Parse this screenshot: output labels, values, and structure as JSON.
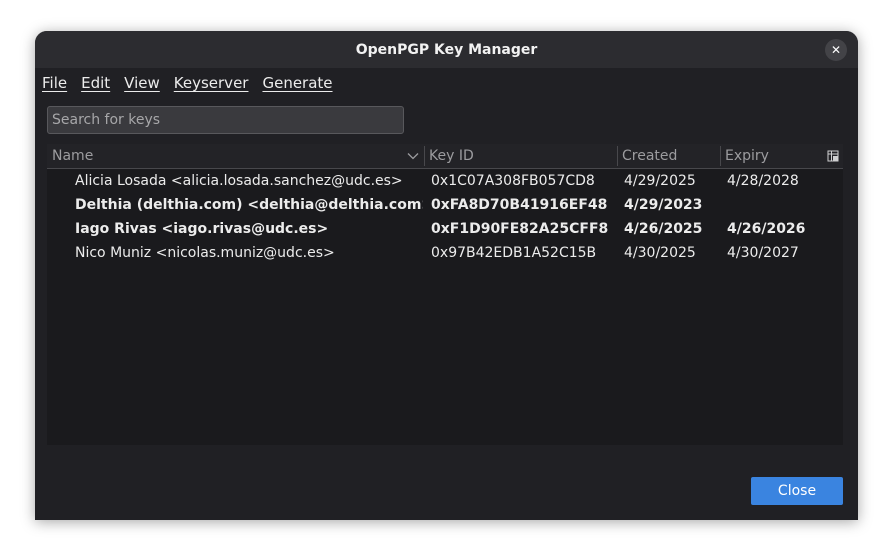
{
  "window": {
    "title": "OpenPGP Key Manager",
    "close_glyph": "✕"
  },
  "menubar": {
    "items": [
      {
        "label": "File"
      },
      {
        "label": "Edit"
      },
      {
        "label": "View"
      },
      {
        "label": "Keyserver"
      },
      {
        "label": "Generate"
      }
    ]
  },
  "search": {
    "placeholder": "Search for keys",
    "value": ""
  },
  "table": {
    "columns": [
      {
        "label": "Name"
      },
      {
        "label": "Key ID"
      },
      {
        "label": "Created"
      },
      {
        "label": "Expiry"
      }
    ],
    "sort_icon": "chevron-down-icon",
    "column_picker_icon": "column-picker-icon",
    "rows": [
      {
        "name": "Alicia Losada <alicia.losada.sanchez@udc.es>",
        "key_id": "0x1C07A308FB057CD8",
        "created": "4/29/2025",
        "expiry": "4/28/2028",
        "bold": false
      },
      {
        "name": "Delthia (delthia.com) <delthia@delthia.com>",
        "key_id": "0xFA8D70B41916EF48",
        "created": "4/29/2023",
        "expiry": "",
        "bold": true
      },
      {
        "name": "Iago Rivas <iago.rivas@udc.es>",
        "key_id": "0xF1D90FE82A25CFF8",
        "created": "4/26/2025",
        "expiry": "4/26/2026",
        "bold": true
      },
      {
        "name": "Nico Muniz <nicolas.muniz@udc.es>",
        "key_id": "0x97B42EDB1A52C15B",
        "created": "4/30/2025",
        "expiry": "4/30/2027",
        "bold": false
      }
    ]
  },
  "footer": {
    "close_label": "Close"
  },
  "colors": {
    "window_bg": "#202024",
    "titlebar_bg": "#2c2c30",
    "accent": "#3a84e0"
  }
}
